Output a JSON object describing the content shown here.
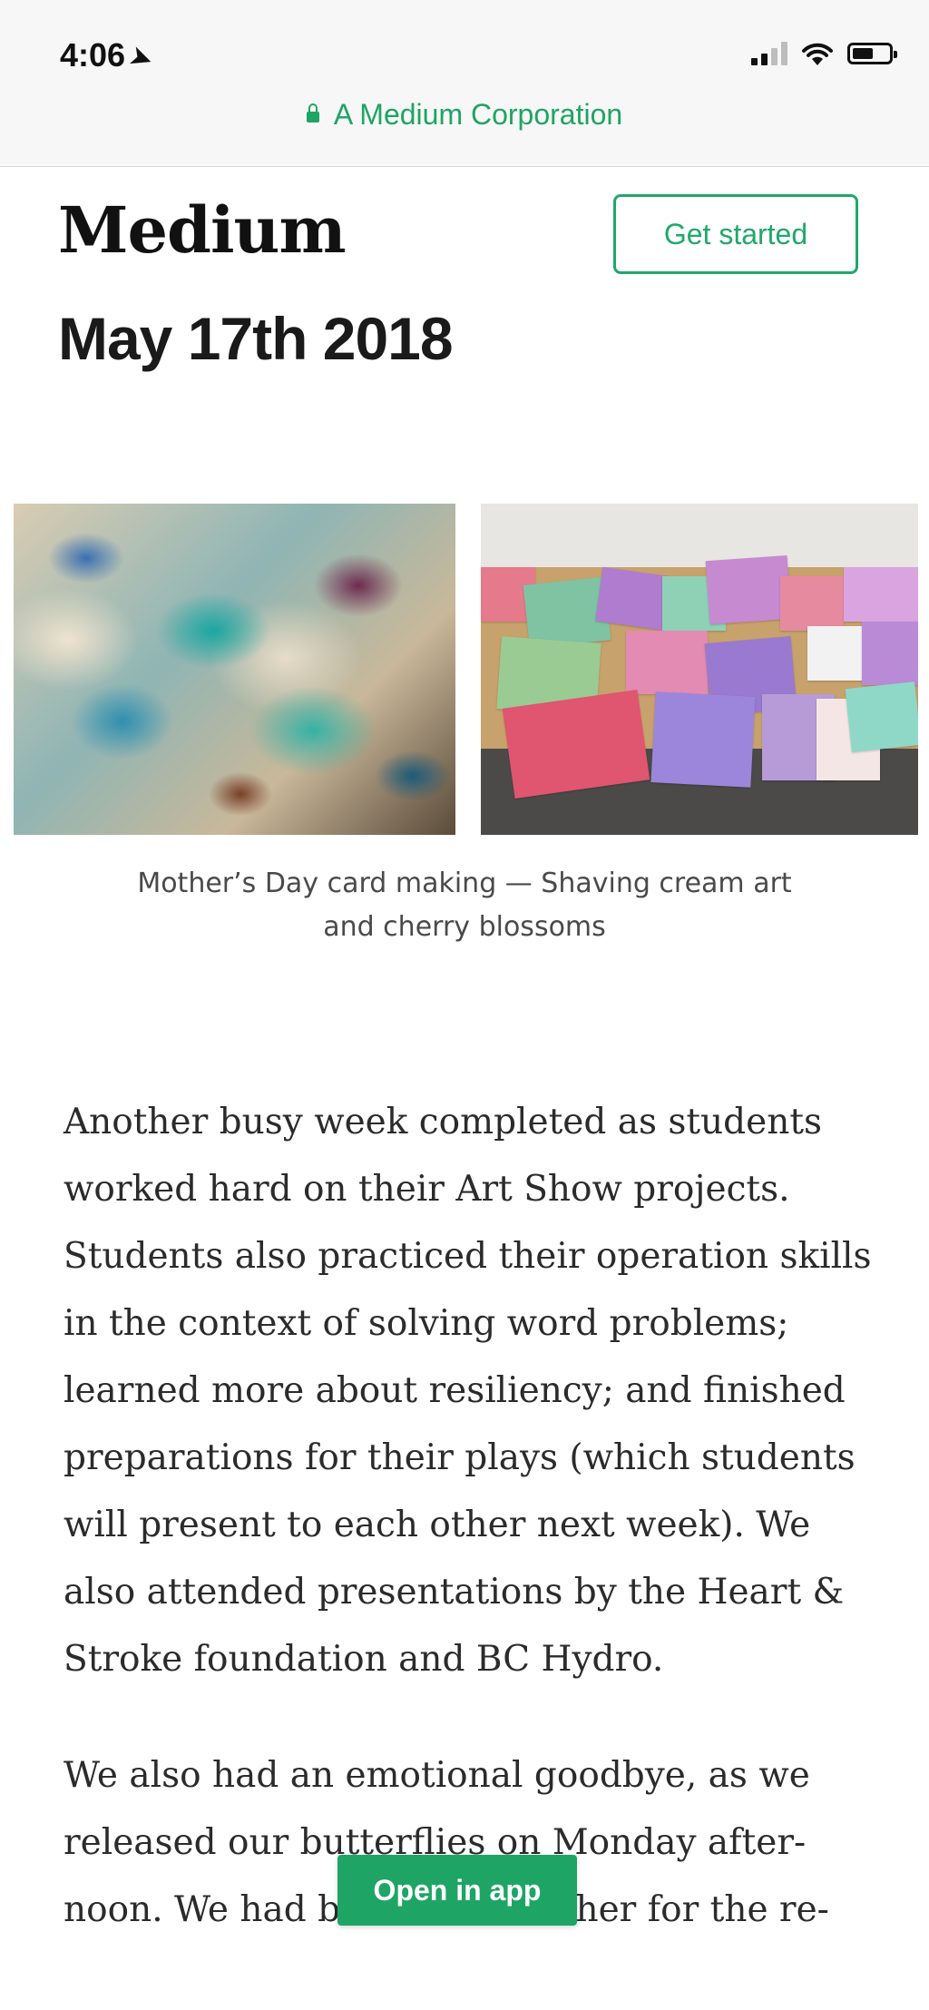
{
  "status_bar": {
    "time": "4:06",
    "location_glyph": "➤"
  },
  "browser": {
    "site_label": "A Medium Corporation"
  },
  "header": {
    "logo_text": "Medium",
    "get_started_label": "Get started"
  },
  "post": {
    "title": "May 17th 2018",
    "caption_line1": "Mother’s Day card making — Shaving cream art",
    "caption_line2": "and cherry blossoms",
    "paragraph1": "Another busy week completed as students worked hard on their Art Show projects. Students also practiced their operation skills in the context of solving word problems; learned more about resiliency; and finished preparations for their plays (which students will present to each other next week). We also attended presentations by the Heart & Stroke foundation and BC Hydro.",
    "paragraph2_lines": [
      "We also had an emotional goodbye, as we",
      "released our butterflies on Monday after-",
      "noon. We had beautiful weather for the re-"
    ]
  },
  "open_in_app_label": "Open in app",
  "colors": {
    "accent": "#1ea565",
    "site_label": "#1fa463"
  },
  "icons": {
    "lock": "lock-icon",
    "signal": "cellular-signal-icon",
    "wifi": "wifi-icon",
    "battery": "battery-icon"
  }
}
